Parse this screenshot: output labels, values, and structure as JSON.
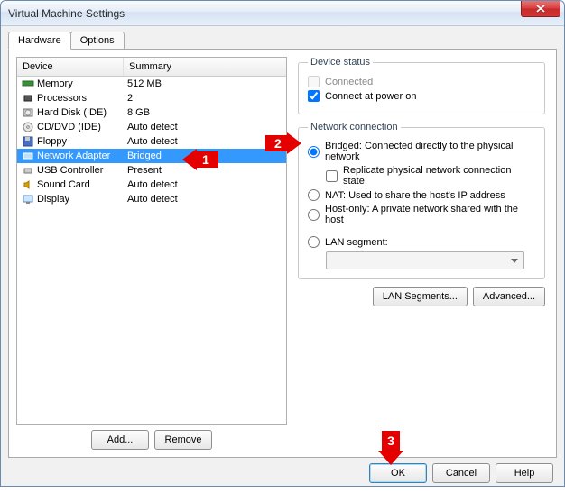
{
  "window": {
    "title": "Virtual Machine Settings"
  },
  "tabs": {
    "hardware": "Hardware",
    "options": "Options"
  },
  "table": {
    "headers": {
      "device": "Device",
      "summary": "Summary"
    },
    "rows": [
      {
        "device": "Memory",
        "summary": "512 MB",
        "icon": "memory"
      },
      {
        "device": "Processors",
        "summary": "2",
        "icon": "cpu"
      },
      {
        "device": "Hard Disk (IDE)",
        "summary": "8 GB",
        "icon": "hdd"
      },
      {
        "device": "CD/DVD (IDE)",
        "summary": "Auto detect",
        "icon": "cd"
      },
      {
        "device": "Floppy",
        "summary": "Auto detect",
        "icon": "floppy"
      },
      {
        "device": "Network Adapter",
        "summary": "Bridged",
        "icon": "net",
        "selected": true
      },
      {
        "device": "USB Controller",
        "summary": "Present",
        "icon": "usb"
      },
      {
        "device": "Sound Card",
        "summary": "Auto detect",
        "icon": "sound"
      },
      {
        "device": "Display",
        "summary": "Auto detect",
        "icon": "display"
      }
    ]
  },
  "buttons": {
    "add": "Add...",
    "remove": "Remove",
    "lan_segments": "LAN Segments...",
    "advanced": "Advanced...",
    "ok": "OK",
    "cancel": "Cancel",
    "help": "Help"
  },
  "device_status": {
    "legend": "Device status",
    "connected": "Connected",
    "connect_power_on": "Connect at power on"
  },
  "network": {
    "legend": "Network connection",
    "bridged": "Bridged: Connected directly to the physical network",
    "replicate": "Replicate physical network connection state",
    "nat": "NAT: Used to share the host's IP address",
    "host_only": "Host-only: A private network shared with the host",
    "lan_segment": "LAN segment:"
  },
  "callouts": {
    "c1": "1",
    "c2": "2",
    "c3": "3"
  }
}
